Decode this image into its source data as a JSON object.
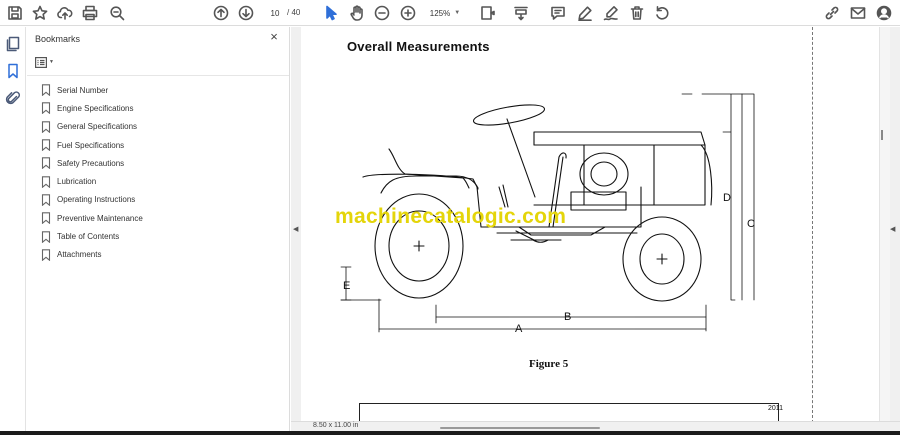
{
  "toolbar": {
    "page_current": "10",
    "page_total": "/ 40",
    "zoom": "125%",
    "icons": [
      "save-icon",
      "bookmark-star-icon",
      "upload-icon",
      "print-icon",
      "zoom-search-icon",
      "prev-page-icon",
      "next-page-icon",
      "select-cursor-icon",
      "hand-icon",
      "zoom-out-icon",
      "zoom-in-icon",
      "fit-page-icon",
      "scroll-mode-icon",
      "comment-icon",
      "highlight-pen-icon",
      "fill-sign-icon",
      "delete-icon",
      "rotate-icon",
      "share-link-icon",
      "email-icon",
      "account-icon"
    ]
  },
  "leftrail": {
    "icons": [
      "pages-icon",
      "bookmarks-icon",
      "attachments-icon"
    ]
  },
  "bookmarks_panel": {
    "title": "Bookmarks",
    "close": "×",
    "items": [
      {
        "label": "Serial Number"
      },
      {
        "label": "Engine Specifications"
      },
      {
        "label": "General Specifications"
      },
      {
        "label": "Fuel Specifications"
      },
      {
        "label": "Safety Precautions"
      },
      {
        "label": "Lubrication"
      },
      {
        "label": "Operating Instructions"
      },
      {
        "label": "Preventive Maintenance"
      },
      {
        "label": "Table of Contents"
      },
      {
        "label": "Attachments"
      }
    ]
  },
  "document": {
    "heading": "Overall Measurements",
    "figure_caption": "Figure 5",
    "watermark": "machinecatalogic.com",
    "dimension_labels": {
      "a": "A",
      "b": "B",
      "c": "C",
      "d": "D",
      "e": "E"
    },
    "table_fragment": "2011"
  },
  "status": {
    "page_size": "8.50 x 11.00 in"
  },
  "colors": {
    "watermark": "#e4d50a",
    "toolbar_icon": "#555555",
    "rail_icon": "#4b5a78",
    "doc_background": "#f0f0f0"
  }
}
